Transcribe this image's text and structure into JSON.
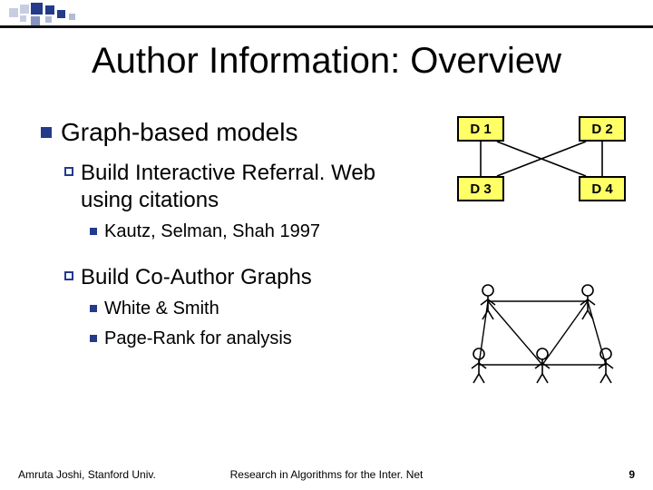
{
  "title": "Author Information: Overview",
  "body": {
    "h1": "Graph-based models",
    "a_h2": "Build Interactive Referral. Web using citations",
    "a_i1": "Kautz, Selman, Shah 1997",
    "b_h2": "Build Co-Author Graphs",
    "b_i1": "White & Smith",
    "b_i2": "Page-Rank for analysis"
  },
  "diagram": {
    "nodes": [
      "D 1",
      "D 2",
      "D 3",
      "D 4"
    ]
  },
  "footer": {
    "left": "Amruta Joshi, Stanford Univ.",
    "center": "Research in Algorithms for the Inter. Net",
    "right": "9"
  }
}
